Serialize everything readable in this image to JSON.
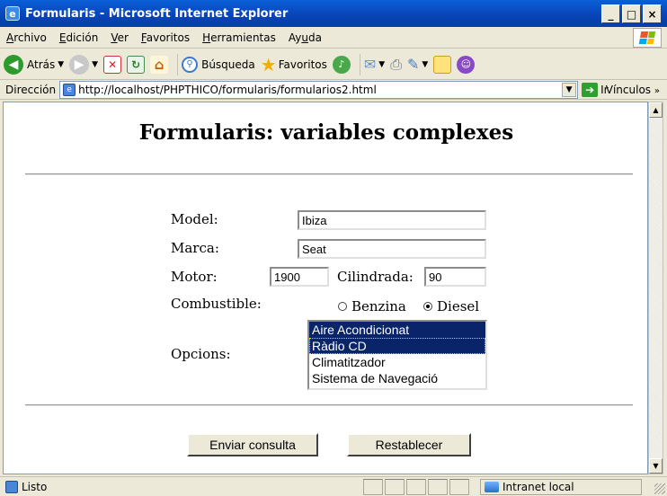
{
  "window": {
    "title": "Formularis - Microsoft Internet Explorer",
    "minimize": "_",
    "maximize": "□",
    "close": "×"
  },
  "menu": [
    {
      "pre": "",
      "key": "A",
      "post": "rchivo"
    },
    {
      "pre": "",
      "key": "E",
      "post": "dición"
    },
    {
      "pre": "",
      "key": "V",
      "post": "er"
    },
    {
      "pre": "",
      "key": "F",
      "post": "avoritos"
    },
    {
      "pre": "",
      "key": "H",
      "post": "erramientas"
    },
    {
      "pre": "Ay",
      "key": "u",
      "post": "da"
    }
  ],
  "toolbar": {
    "back_label": "Atrás",
    "search_label": "Búsqueda",
    "favorites_label": "Favoritos"
  },
  "address": {
    "label": "Dirección",
    "url": "http://localhost/PHPTHICO/formularis/formularios2.html",
    "go_label": "Ir",
    "links_label": "Vínculos"
  },
  "page": {
    "title": "Formularis: variables complexes",
    "model_label": "Model:",
    "model_value": "Ibiza",
    "marca_label": "Marca:",
    "marca_value": "Seat",
    "motor_label": "Motor:",
    "motor_value": "1900",
    "cilindrada_label": "Cilindrada:",
    "cilindrada_value": "90",
    "combustible_label": "Combustible:",
    "fuel_options": [
      {
        "label": "Benzina",
        "checked": false
      },
      {
        "label": "Diesel",
        "checked": true
      }
    ],
    "opcions_label": "Opcions:",
    "options": [
      {
        "label": "Aire Acondicionat",
        "selected": true
      },
      {
        "label": "Ràdio CD",
        "selected": true
      },
      {
        "label": "Climatitzador",
        "selected": false
      },
      {
        "label": "Sistema de Navegació",
        "selected": false
      }
    ],
    "submit_label": "Enviar consulta",
    "reset_label": "Restablecer"
  },
  "status": {
    "text": "Listo",
    "zone": "Intranet local"
  },
  "colors": {
    "titlebar": "#0a4fc8",
    "selection": "#0a246a"
  }
}
